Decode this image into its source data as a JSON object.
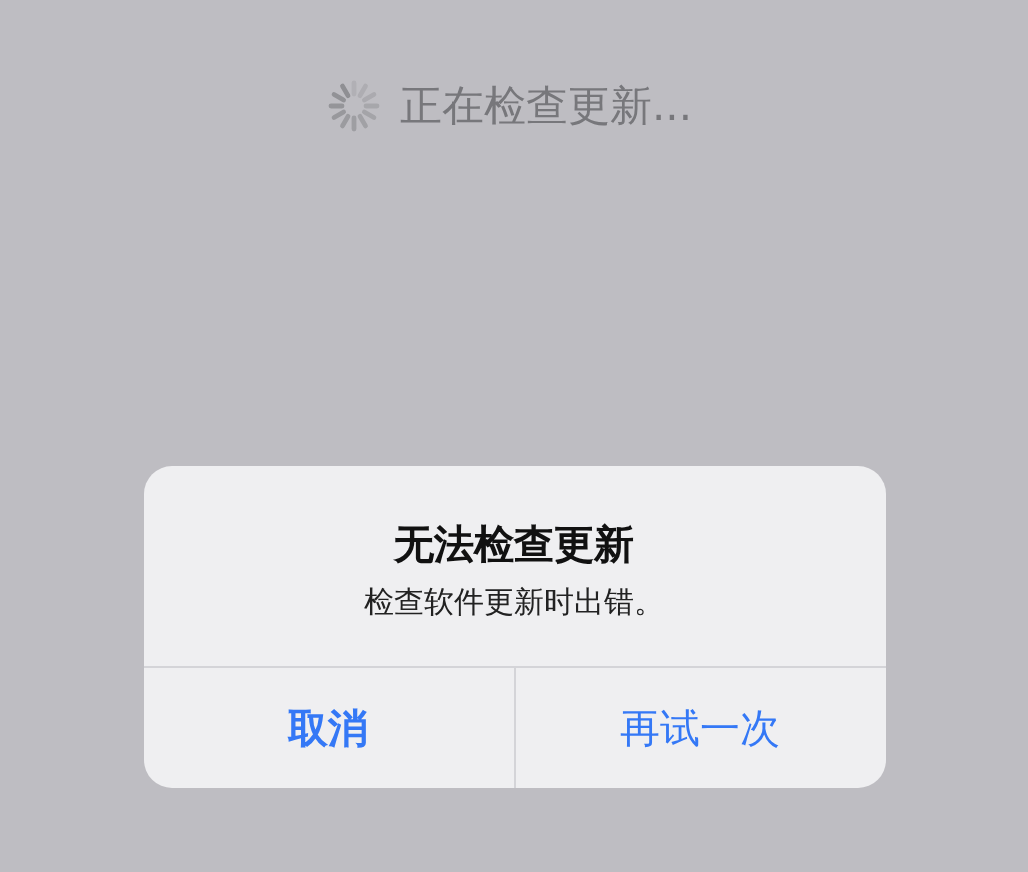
{
  "status": {
    "text": "正在检查更新..."
  },
  "alert": {
    "title": "无法检查更新",
    "message": "检查软件更新时出错。",
    "buttons": [
      {
        "label": "取消",
        "bold": true
      },
      {
        "label": "再试一次",
        "bold": false
      }
    ]
  }
}
